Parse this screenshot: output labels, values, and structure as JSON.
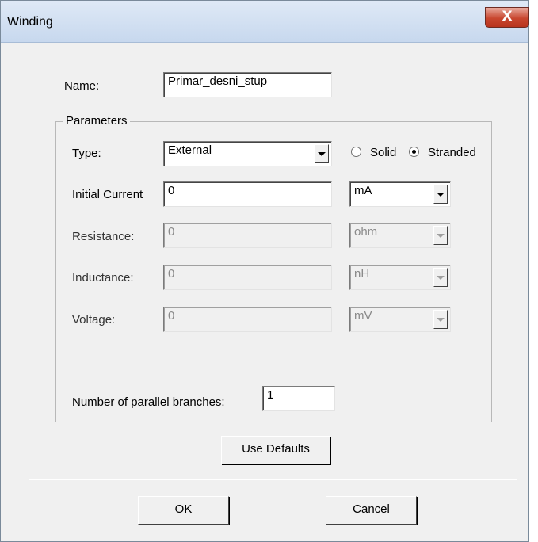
{
  "window": {
    "title": "Winding",
    "close_glyph": "X"
  },
  "name_field": {
    "label": "Name:",
    "value": "Primar_desni_stup"
  },
  "parameters": {
    "group_label": "Parameters",
    "type": {
      "label": "Type:",
      "value": "External"
    },
    "conductor": {
      "options": [
        {
          "label": "Solid",
          "selected": false
        },
        {
          "label": "Stranded",
          "selected": true
        }
      ]
    },
    "initial_current": {
      "label": "Initial Current",
      "value": "0",
      "unit": "mA",
      "enabled": true
    },
    "resistance": {
      "label": "Resistance:",
      "value": "0",
      "unit": "ohm",
      "enabled": false
    },
    "inductance": {
      "label": "Inductance:",
      "value": "0",
      "unit": "nH",
      "enabled": false
    },
    "voltage": {
      "label": "Voltage:",
      "value": "0",
      "unit": "mV",
      "enabled": false
    },
    "parallel_branches": {
      "label": "Number of parallel branches:",
      "value": "1"
    }
  },
  "buttons": {
    "use_defaults": "Use Defaults",
    "ok": "OK",
    "cancel": "Cancel"
  },
  "icons": {
    "dropdown": "chevron-down-icon",
    "close": "close-icon"
  },
  "colors": {
    "dialog_bg": "#f0f0f0",
    "close_button": "#c8462f",
    "titlebar": "#c7d8ee"
  }
}
